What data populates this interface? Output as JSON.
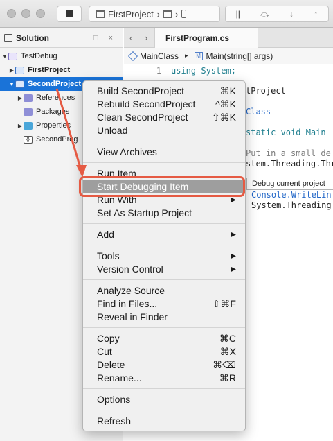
{
  "toolbar": {
    "breadcrumb": {
      "project": "FirstProject",
      "sep": "›"
    },
    "run_icons": [
      "||",
      "⤼",
      "↓",
      "↑"
    ]
  },
  "solution_pad": {
    "title": "Solution",
    "controls": "□ ×",
    "tree": [
      {
        "label": "TestDebug",
        "icon": "solution-icon"
      },
      {
        "label": "FirstProject",
        "icon": "project-icon",
        "bold": true
      },
      {
        "label": "SecondProject",
        "icon": "project-icon",
        "bold": true,
        "selected": true
      },
      {
        "label": "References",
        "icon": "references-icon"
      },
      {
        "label": "Packages",
        "icon": "packages-icon"
      },
      {
        "label": "Properties",
        "icon": "folder-icon"
      },
      {
        "label": "SecondProg",
        "icon": "cs-file-icon"
      }
    ]
  },
  "editor": {
    "tab_title": "FirstProgram.cs",
    "path": {
      "class": "MainClass",
      "sep": "▸",
      "method": "Main(string[] args)"
    },
    "lines": [
      {
        "num": "1",
        "text": "using System;"
      },
      {
        "num": "",
        "text": "tProject"
      },
      {
        "num": "",
        "text": "Class"
      },
      {
        "num": "",
        "text": "static void Main"
      },
      {
        "num": "",
        "text": "Put in a small de"
      },
      {
        "num": "",
        "text": "stem.Threading.Thr"
      },
      {
        "num": "",
        "text": "Console.WriteLin"
      },
      {
        "num": "",
        "text": "System.Threading"
      }
    ],
    "tooltip": "Debug current project"
  },
  "context_menu": {
    "items": [
      {
        "label": "Build SecondProject",
        "shortcut": "⌘K"
      },
      {
        "label": "Rebuild SecondProject",
        "shortcut": "^⌘K"
      },
      {
        "label": "Clean SecondProject",
        "shortcut": "⇧⌘K"
      },
      {
        "label": "Unload",
        "shortcut": ""
      },
      {
        "label": "View Archives",
        "shortcut": ""
      },
      {
        "label": "Run Item",
        "shortcut": ""
      },
      {
        "label": "Start Debugging Item",
        "shortcut": "",
        "highlighted": true
      },
      {
        "label": "Run With",
        "shortcut": "",
        "submenu": true
      },
      {
        "label": "Set As Startup Project",
        "shortcut": ""
      },
      {
        "label": "Add",
        "shortcut": "",
        "submenu": true
      },
      {
        "label": "Tools",
        "shortcut": "",
        "submenu": true
      },
      {
        "label": "Version Control",
        "shortcut": "",
        "submenu": true
      },
      {
        "label": "Analyze Source",
        "shortcut": ""
      },
      {
        "label": "Find in Files...",
        "shortcut": "⇧⌘F"
      },
      {
        "label": "Reveal in Finder",
        "shortcut": ""
      },
      {
        "label": "Copy",
        "shortcut": "⌘C"
      },
      {
        "label": "Cut",
        "shortcut": "⌘X"
      },
      {
        "label": "Delete",
        "shortcut": "⌘⌫"
      },
      {
        "label": "Rename...",
        "shortcut": "⌘R"
      },
      {
        "label": "Options",
        "shortcut": ""
      },
      {
        "label": "Refresh",
        "shortcut": ""
      }
    ],
    "submenu_arrow": "▶"
  },
  "colors": {
    "selection": "#1a73d8",
    "menu_highlight": "#9e9e9e",
    "annotation": "#e55a43"
  }
}
